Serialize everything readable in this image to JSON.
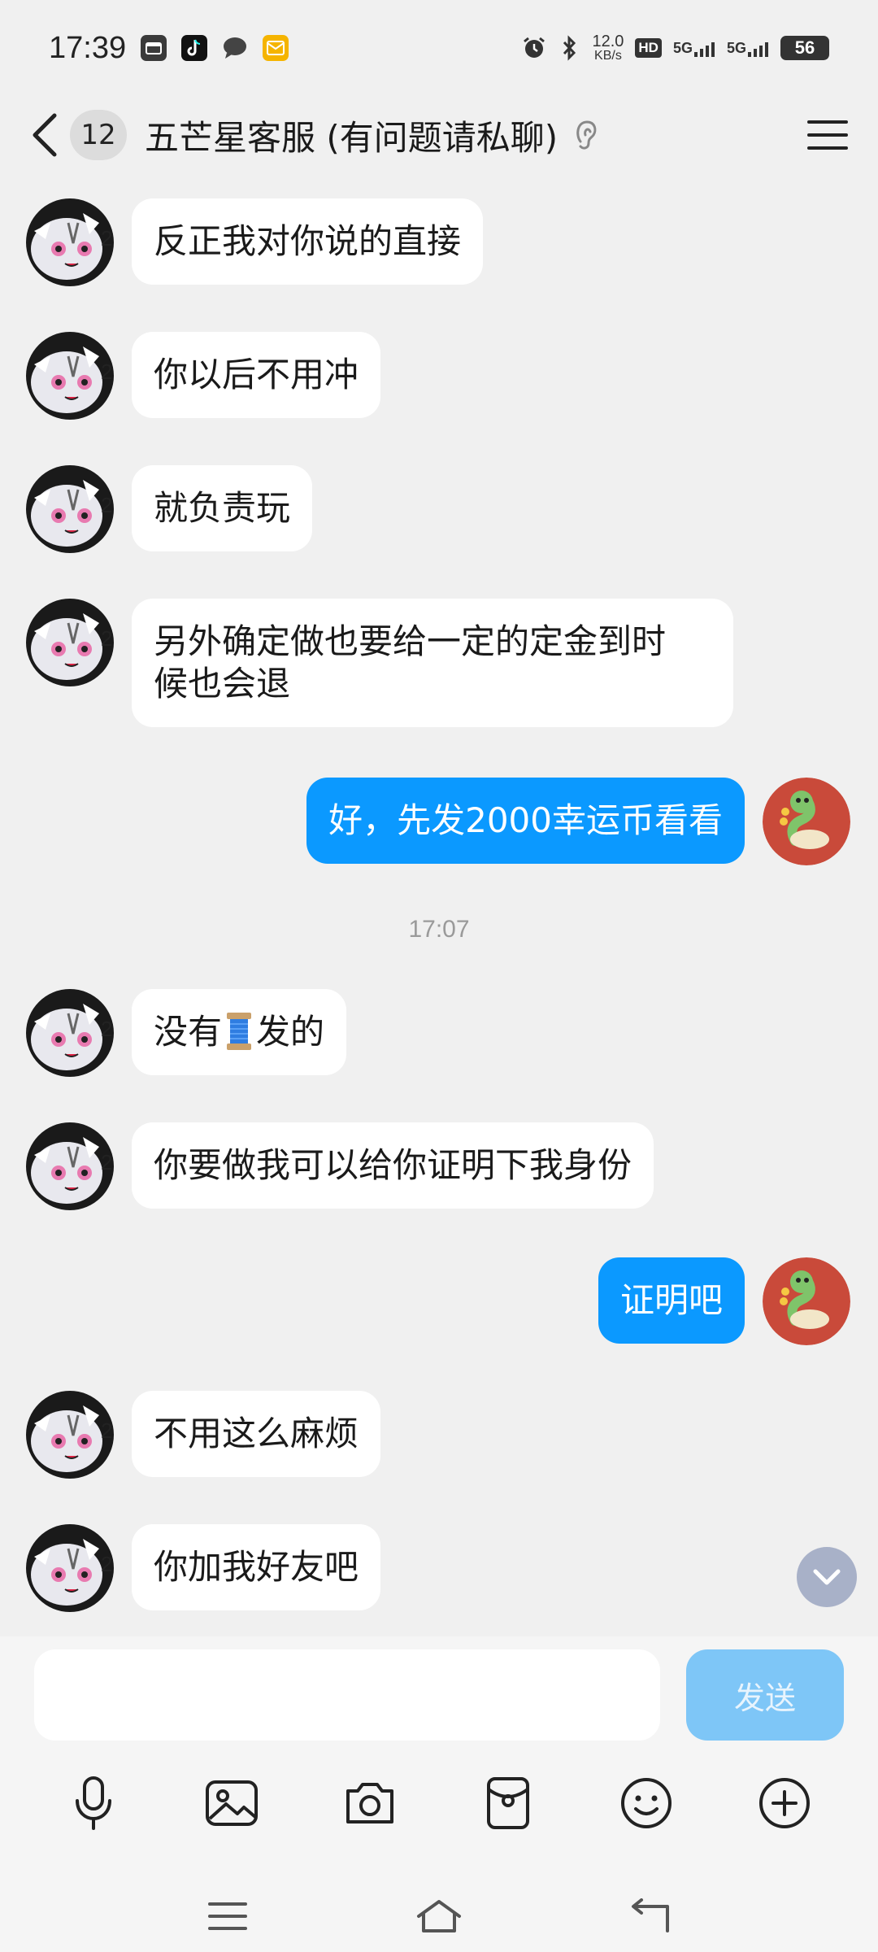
{
  "status_bar": {
    "time": "17:39",
    "net_speed_value": "12.0",
    "net_speed_unit": "KB/s",
    "signal_1": "5G",
    "signal_2": "5G",
    "hd_label": "HD",
    "battery": "56"
  },
  "header": {
    "unread_count": "12",
    "title": "五芒星客服 (有问题请私聊)"
  },
  "messages": [
    {
      "side": "left",
      "text": "反正我对你说的直接"
    },
    {
      "side": "left",
      "text": "你以后不用冲"
    },
    {
      "side": "left",
      "text": "就负责玩"
    },
    {
      "side": "left",
      "line1": "另外确定做也要给一定的定金到时",
      "line2": "候也会退"
    },
    {
      "side": "right",
      "text": "好，先发2000幸运币看看"
    },
    {
      "type": "timestamp",
      "text": "17:07"
    },
    {
      "side": "left",
      "before": "没有",
      "emoji": "spool-emoji",
      "after": "发的"
    },
    {
      "side": "left",
      "text": "你要做我可以给你证明下我身份"
    },
    {
      "side": "right",
      "text": "证明吧"
    },
    {
      "side": "left",
      "text": "不用这么麻烦"
    },
    {
      "side": "left",
      "text": "你加我好友吧"
    }
  ],
  "input": {
    "value": "",
    "send_label": "发送"
  },
  "toolbar_icons": [
    "microphone-icon",
    "image-icon",
    "camera-icon",
    "red-packet-icon",
    "emoji-icon",
    "plus-icon"
  ],
  "nav_icons": [
    "menu-icon",
    "home-icon",
    "back-icon"
  ],
  "colors": {
    "background": "#f0f0f0",
    "incoming_bubble": "#ffffff",
    "outgoing_bubble": "#0b99ff",
    "send_button_disabled": "#7ec6f7",
    "scroll_button": "#a8b1c8"
  }
}
